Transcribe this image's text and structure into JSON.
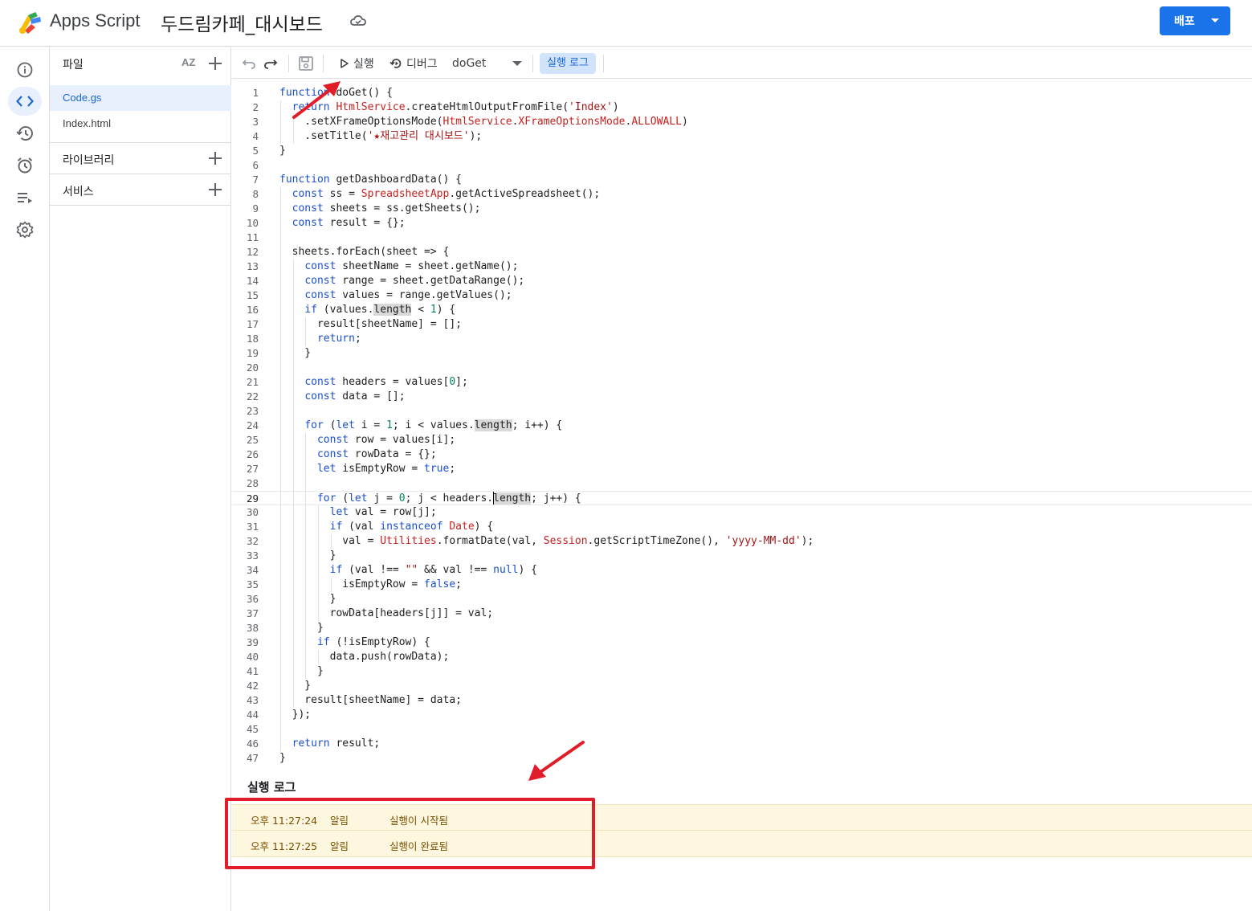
{
  "header": {
    "app_name": "Apps Script",
    "project_title": "두드림카페_대시보드",
    "deploy_label": "배포"
  },
  "rail": {
    "items": [
      "info-icon",
      "code-icon",
      "history-icon",
      "trigger-clock-icon",
      "executions-icon",
      "settings-gear-icon"
    ]
  },
  "files_panel": {
    "title": "파일",
    "sort_label": "AZ",
    "files": [
      "Code.gs",
      "Index.html"
    ],
    "libraries_label": "라이브러리",
    "services_label": "서비스"
  },
  "toolbar": {
    "run_label": "실행",
    "debug_label": "디버그",
    "function_selected": "doGet",
    "log_label": "실행 로그"
  },
  "editor": {
    "current_line": 29,
    "lines": [
      "function doGet() {",
      "  return HtmlService.createHtmlOutputFromFile('Index')",
      "    .setXFrameOptionsMode(HtmlService.XFrameOptionsMode.ALLOWALL)",
      "    .setTitle('★재고관리 대시보드');",
      "}",
      "",
      "function getDashboardData() {",
      "  const ss = SpreadsheetApp.getActiveSpreadsheet();",
      "  const sheets = ss.getSheets();",
      "  const result = {};",
      "",
      "  sheets.forEach(sheet => {",
      "    const sheetName = sheet.getName();",
      "    const range = sheet.getDataRange();",
      "    const values = range.getValues();",
      "    if (values.length < 1) {",
      "      result[sheetName] = [];",
      "      return;",
      "    }",
      "",
      "    const headers = values[0];",
      "    const data = [];",
      "",
      "    for (let i = 1; i < values.length; i++) {",
      "      const row = values[i];",
      "      const rowData = {};",
      "      let isEmptyRow = true;",
      "",
      "      for (let j = 0; j < headers.length; j++) {",
      "        let val = row[j];",
      "        if (val instanceof Date) {",
      "          val = Utilities.formatDate(val, Session.getScriptTimeZone(), 'yyyy-MM-dd');",
      "        }",
      "        if (val !== \"\" && val !== null) {",
      "          isEmptyRow = false;",
      "        }",
      "        rowData[headers[j]] = val;",
      "      }",
      "      if (!isEmptyRow) {",
      "        data.push(rowData);",
      "      }",
      "    }",
      "    result[sheetName] = data;",
      "  });",
      "",
      "  return result;",
      "}"
    ]
  },
  "log_panel": {
    "title": "실행 로그",
    "entries": [
      {
        "time": "오후 11:27:24",
        "level": "알림",
        "message": "실행이 시작됨"
      },
      {
        "time": "오후 11:27:25",
        "level": "알림",
        "message": "실행이 완료됨"
      }
    ]
  },
  "colors": {
    "keyword": "#1a4fcf",
    "class_name": "#c5221f",
    "string": "#a31515",
    "number": "#098658",
    "accent": "#1a73e8",
    "annotation_red": "#e11d2a"
  }
}
